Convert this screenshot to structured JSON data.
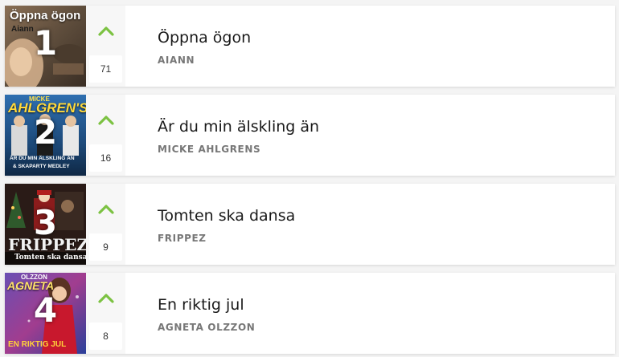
{
  "colors": {
    "accent_green": "#7cc242",
    "weeks_text": "#333333",
    "artist_text": "#777777"
  },
  "entries": [
    {
      "rank": "1",
      "title": "Öppna ögon",
      "artist": "AIANN",
      "weeks": "71",
      "trend": "up",
      "trend_icon": "chevron-up-icon",
      "cover": {
        "title": "Öppna ögon",
        "subtitle": "Aiann"
      }
    },
    {
      "rank": "2",
      "title": "Är du min älskling än",
      "artist": "MICKE AHLGRENS",
      "weeks": "16",
      "trend": "up",
      "trend_icon": "chevron-up-icon",
      "cover": {
        "title": "AHLGREN'S",
        "top": "MICKE",
        "subtitle": "ÄR DU MIN ÄLSKLING ÄN",
        "subtitle2": "& SKAPARTY MEDLEY"
      }
    },
    {
      "rank": "3",
      "title": "Tomten ska dansa",
      "artist": "FRIPPEZ",
      "weeks": "9",
      "trend": "up",
      "trend_icon": "chevron-up-icon",
      "cover": {
        "title": "FRIPPEZ",
        "subtitle": "Tomten ska dansa"
      }
    },
    {
      "rank": "4",
      "title": "En riktig jul",
      "artist": "AGNETA OLZZON",
      "weeks": "8",
      "trend": "up",
      "trend_icon": "chevron-up-icon",
      "cover": {
        "title": "AGNETA",
        "top": "OLZZON",
        "subtitle": "EN RIKTIG JUL"
      }
    }
  ]
}
